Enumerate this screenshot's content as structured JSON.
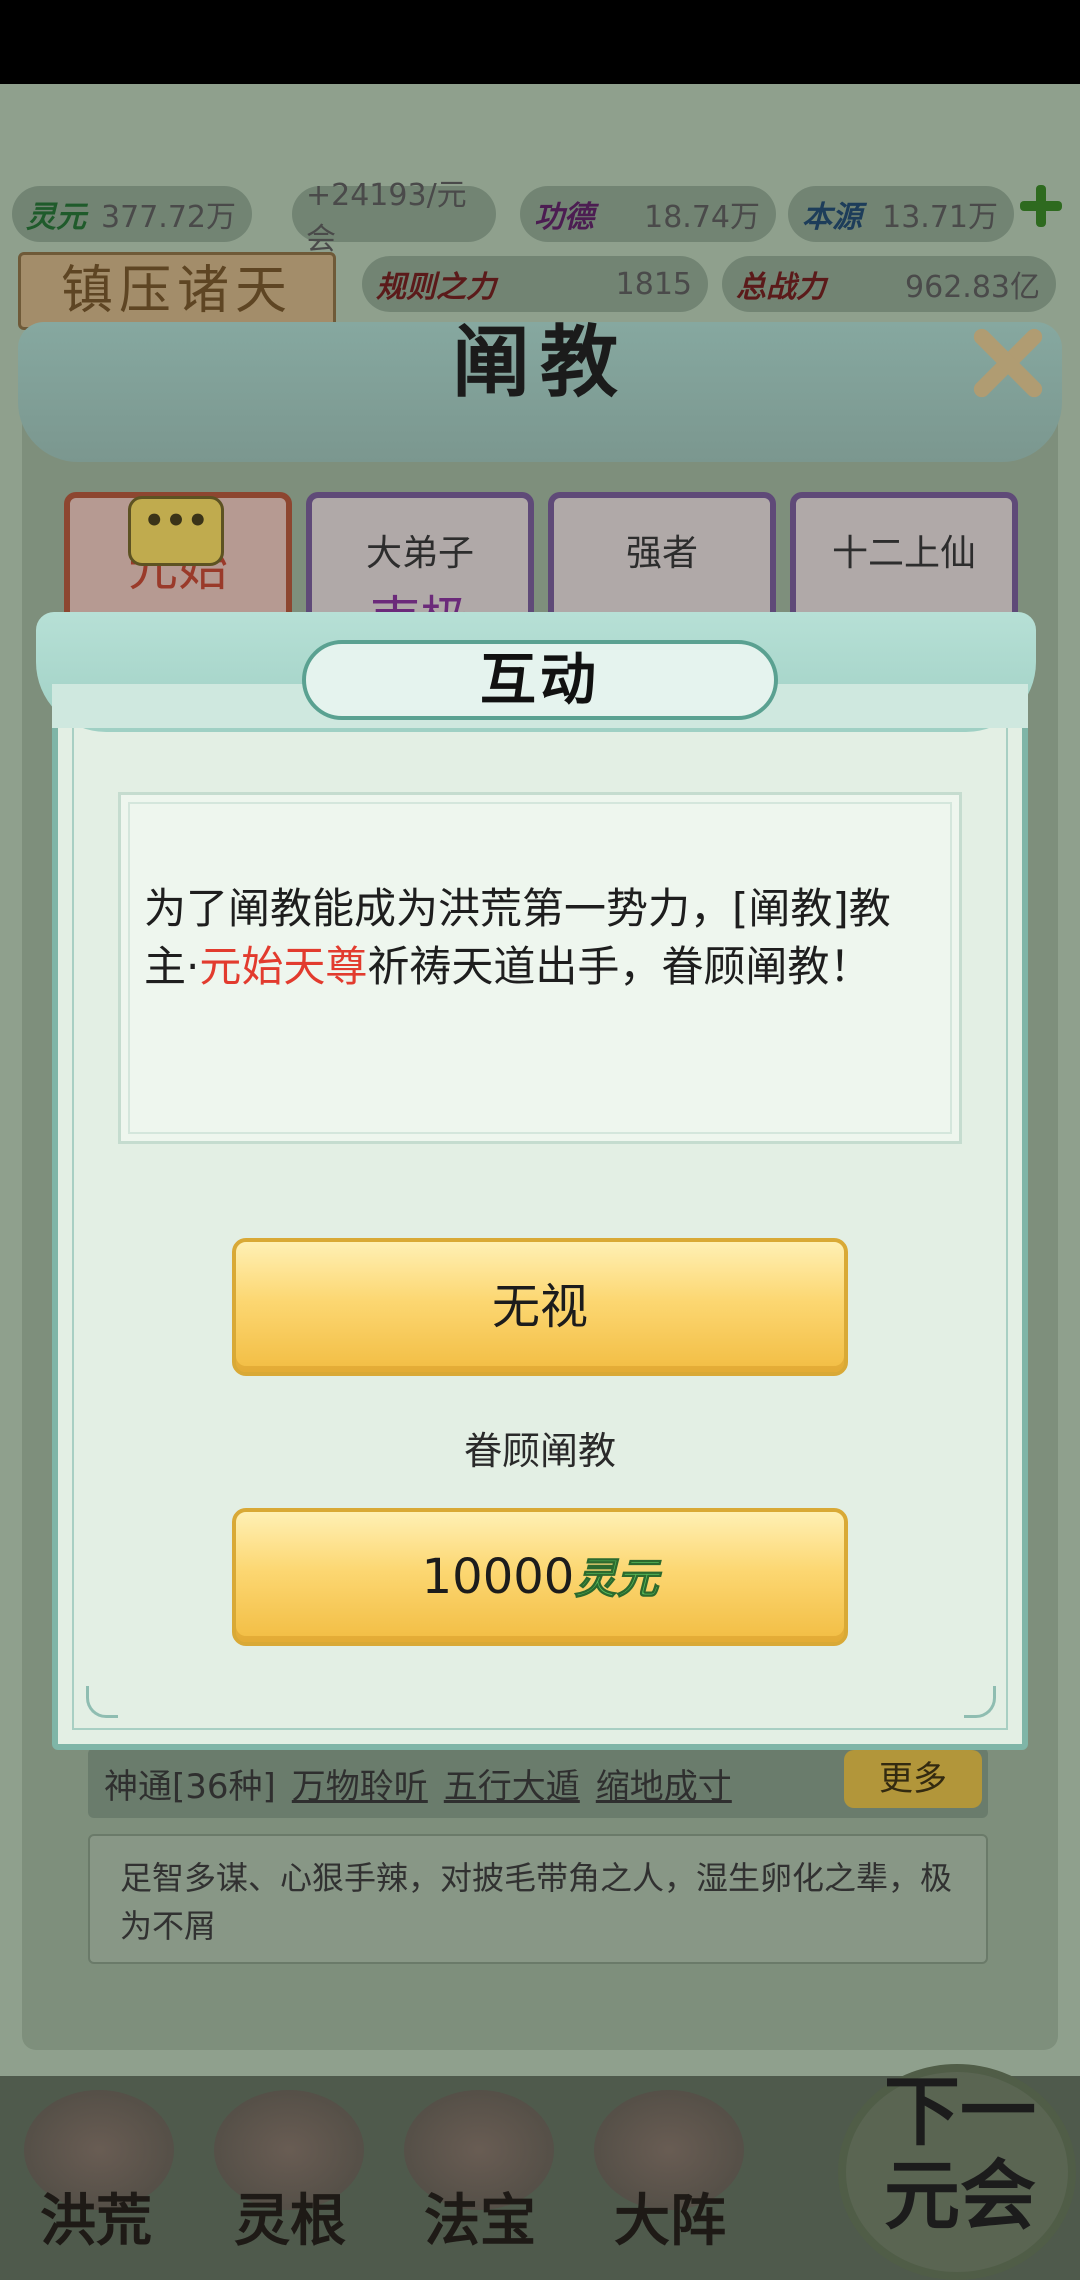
{
  "top_bar": {
    "resources": [
      {
        "key": "灵元",
        "value": "377.72万"
      },
      {
        "key": "",
        "value": "+24193/元会"
      },
      {
        "key": "功德",
        "value": "18.74万"
      },
      {
        "key": "本源",
        "value": "13.71万"
      },
      {
        "key": "规则之力",
        "value": "1815"
      },
      {
        "key": "总战力",
        "value": "962.83亿"
      }
    ],
    "zhenya_label": "镇压诸天"
  },
  "sect_panel": {
    "title": "阐教",
    "cards": [
      {
        "role": "",
        "name": "元始"
      },
      {
        "role": "大弟子",
        "name": "南极"
      },
      {
        "role": "强者",
        "name": ""
      },
      {
        "role": "十二上仙",
        "name": ""
      }
    ],
    "bubble": "•••",
    "skills": {
      "label": "神通[36种]",
      "items": [
        "万物聆听",
        "五行大遁",
        "缩地成寸"
      ],
      "more": "更多"
    },
    "description": "足智多谋、心狠手辣，对披毛带角之人，湿生卵化之辈，极为不屑"
  },
  "dialog": {
    "title": "互动",
    "message_part1": "为了阐教能成为洪荒第一势力，[阐教]教主·",
    "message_highlight": "元始天尊",
    "message_part2": "祈祷天道出手，眷顾阐教！",
    "ignore_button": "无视",
    "option_label": "眷顾阐教",
    "pay_amount": "10000",
    "pay_currency": "灵元"
  },
  "bottom_nav": {
    "items": [
      "洪荒",
      "灵根",
      "法宝",
      "大阵"
    ],
    "next": "下一元会"
  },
  "colors": {
    "highlight": "#e23b2e",
    "button_gold": "#fcd772",
    "dialog_bg": "#e3efe4",
    "currency_green": "#5bbd5a"
  }
}
